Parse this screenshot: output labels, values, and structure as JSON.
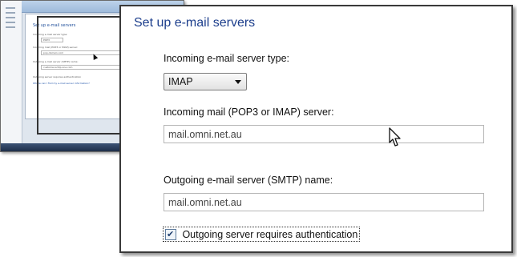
{
  "thumbnail": {
    "title": "Set up e-mail servers",
    "incoming_type_label": "Incoming e-mail server type:",
    "incoming_type_value": "POP3",
    "incoming_server_label": "Incoming mail (POP3 or IMAP) server:",
    "incoming_server_value": "pop.domain.com",
    "outgoing_server_label": "Outgoing e-mail server (SMTP) name:",
    "outgoing_server_value": "customer-smtp.one.com",
    "auth_label": "Outgoing server requires authentication",
    "help_link": "Where can I find my e-mail server information?"
  },
  "dialog": {
    "title": "Set up e-mail servers",
    "incoming_type_label": "Incoming e-mail server type:",
    "incoming_type_value": "IMAP",
    "incoming_server_label": "Incoming mail (POP3 or IMAP) server:",
    "incoming_server_value": "mail.omni.net.au",
    "outgoing_server_label": "Outgoing e-mail server (SMTP) name:",
    "outgoing_server_value": "mail.omni.net.au",
    "auth_label": "Outgoing server requires authentication",
    "auth_checked": true,
    "check_glyph": "✔"
  },
  "colors": {
    "title_blue": "#1c3e8c",
    "border_dark": "#3a3a3a"
  },
  "icons": {
    "cursor": "mouse-pointer-icon",
    "dropdown": "chevron-down-icon",
    "checkbox": "checkbox-checked-icon"
  }
}
